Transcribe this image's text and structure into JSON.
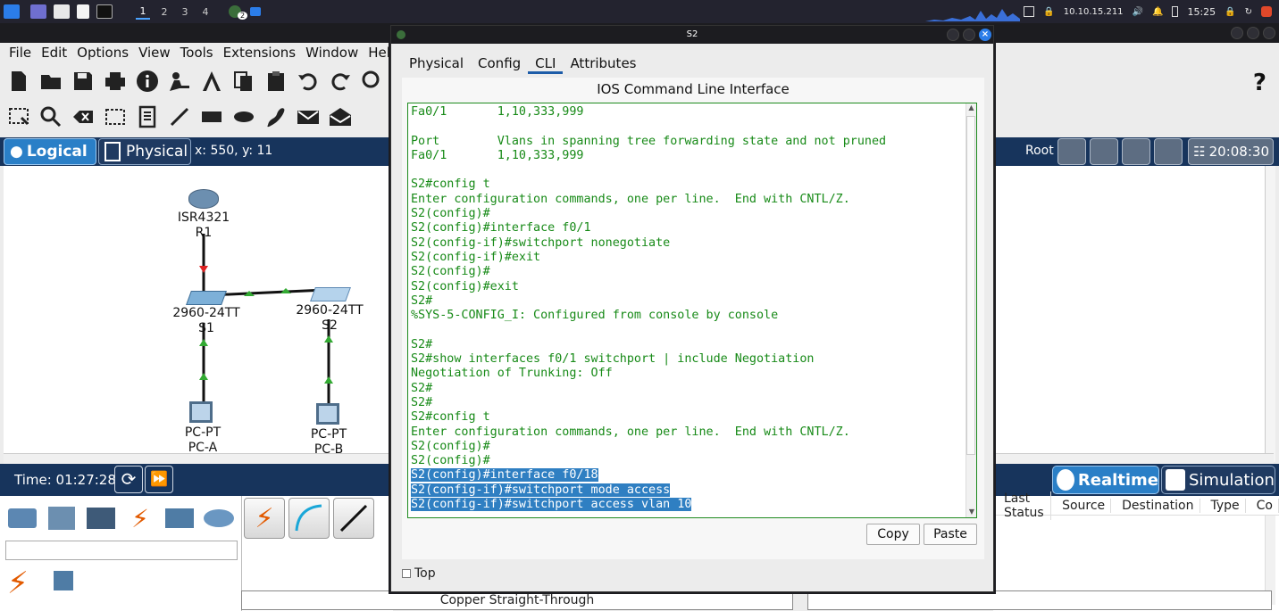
{
  "taskbar": {
    "workspaces": [
      "1",
      "2",
      "3",
      "4"
    ],
    "badge": "2",
    "ip": "10.10.15.211",
    "clock": "15:25"
  },
  "app": {
    "menu": [
      "File",
      "Edit",
      "Options",
      "View",
      "Tools",
      "Extensions",
      "Window",
      "Help"
    ],
    "workspace": {
      "logical_label": "Logical",
      "physical_label": "Physical",
      "coords": "x: 550, y: 11",
      "root_label": "Root",
      "sim_clock": "20:08:30"
    },
    "devices": [
      {
        "type": "ISR4321",
        "name": "R1"
      },
      {
        "type": "2960-24TT",
        "name": "S1"
      },
      {
        "type": "2960-24TT",
        "name": "S2"
      },
      {
        "type": "PC-PT",
        "name": "PC-A"
      },
      {
        "type": "PC-PT",
        "name": "PC-B"
      }
    ],
    "timebar": {
      "time": "Time: 01:27:28",
      "realtime_label": "Realtime",
      "simulation_label": "Simulation"
    },
    "connection_name": "Copper Straight-Through",
    "pdu_columns": [
      "Last Status",
      "Source",
      "Destination",
      "Type",
      "Co"
    ]
  },
  "s2": {
    "title": "S2",
    "tabs": [
      "Physical",
      "Config",
      "CLI",
      "Attributes"
    ],
    "active_tab": "CLI",
    "heading": "IOS Command Line Interface",
    "cli_lines": [
      "Fa0/1       1,10,333,999",
      "",
      "Port        Vlans in spanning tree forwarding state and not pruned",
      "Fa0/1       1,10,333,999",
      "",
      "S2#config t",
      "Enter configuration commands, one per line.  End with CNTL/Z.",
      "S2(config)#",
      "S2(config)#interface f0/1",
      "S2(config-if)#switchport nonegotiate",
      "S2(config-if)#exit",
      "S2(config)#",
      "S2(config)#exit",
      "S2#",
      "%SYS-5-CONFIG_I: Configured from console by console",
      "",
      "S2#",
      "S2#show interfaces f0/1 switchport | include Negotiation",
      "Negotiation of Trunking: Off",
      "S2#",
      "S2#",
      "S2#config t",
      "Enter configuration commands, one per line.  End with CNTL/Z.",
      "S2(config)#",
      "S2(config)#"
    ],
    "cli_selected_lines": [
      "S2(config)#interface f0/18",
      "S2(config-if)#switchport mode access",
      "S2(config-if)#switchport access vlan 10"
    ],
    "copy_label": "Copy",
    "paste_label": "Paste",
    "top_label": "Top",
    "top_checked": false
  }
}
